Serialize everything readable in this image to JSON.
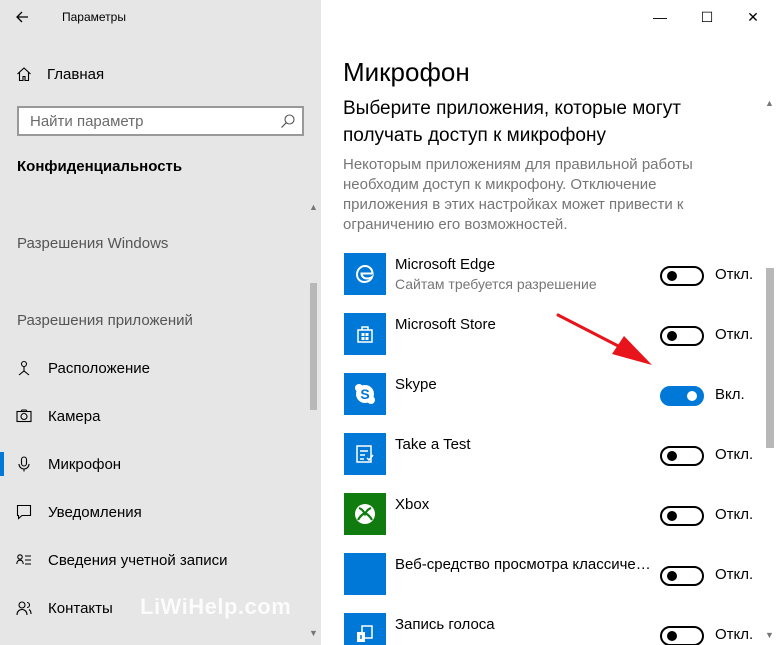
{
  "window": {
    "title": "Параметры",
    "back_icon": "back-arrow-icon",
    "minimize_glyph": "—",
    "maximize_glyph": "☐",
    "close_glyph": "✕"
  },
  "sidebar": {
    "home_label": "Главная",
    "search_placeholder": "Найти параметр",
    "section_title": "Конфиденциальность",
    "group_windows": "Разрешения Windows",
    "group_apps": "Разрешения приложений",
    "items": [
      {
        "label": "Расположение",
        "icon": "location-icon"
      },
      {
        "label": "Камера",
        "icon": "camera-icon"
      },
      {
        "label": "Микрофон",
        "icon": "microphone-icon",
        "active": true
      },
      {
        "label": "Уведомления",
        "icon": "notifications-icon"
      },
      {
        "label": "Сведения учетной записи",
        "icon": "account-info-icon"
      },
      {
        "label": "Контакты",
        "icon": "contacts-icon"
      }
    ],
    "watermark": "LiWiHelp.com"
  },
  "main": {
    "title": "Микрофон",
    "subheading": "Выберите приложения, которые могут получать доступ к микрофону",
    "description": "Некоторым приложениям для правильной работы необходим доступ к микрофону. Отключение приложения в этих настройках может привести к ограничению его возможностей.",
    "apps": [
      {
        "name": "Microsoft Edge",
        "sub": "Сайтам требуется разрешение",
        "state": "Откл.",
        "on": false,
        "icon": "edge-icon"
      },
      {
        "name": "Microsoft Store",
        "sub": "",
        "state": "Откл.",
        "on": false,
        "icon": "store-icon"
      },
      {
        "name": "Skype",
        "sub": "",
        "state": "Вкл.",
        "on": true,
        "icon": "skype-icon"
      },
      {
        "name": "Take a Test",
        "sub": "",
        "state": "Откл.",
        "on": false,
        "icon": "take-a-test-icon"
      },
      {
        "name": "Xbox",
        "sub": "",
        "state": "Откл.",
        "on": false,
        "icon": "xbox-icon"
      },
      {
        "name": "Веб-средство просмотра классиче…",
        "sub": "",
        "state": "Откл.",
        "on": false,
        "icon": "web-viewer-icon"
      },
      {
        "name": "Запись голоса",
        "sub": "",
        "state": "Откл.",
        "on": false,
        "icon": "voice-recorder-icon"
      }
    ]
  },
  "colors": {
    "accent": "#0078d7",
    "sidebar_bg": "#e6e6e6",
    "xbox_green": "#107c10",
    "annotation_red": "#e8141b"
  }
}
